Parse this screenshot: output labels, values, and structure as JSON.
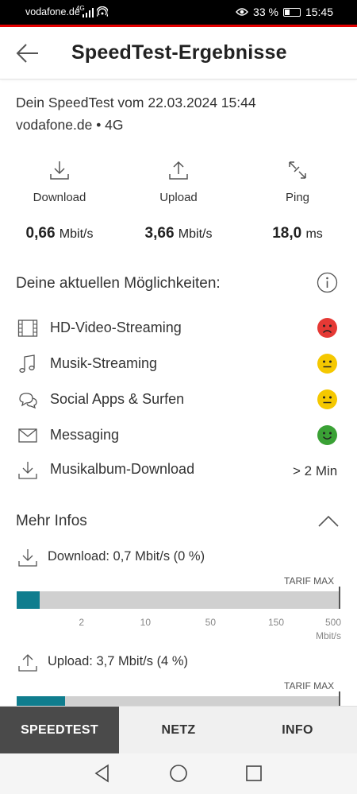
{
  "status": {
    "carrier": "vodafone.de",
    "network_badge": "4G",
    "battery": "33 %",
    "time": "15:45"
  },
  "header": {
    "title": "SpeedTest-Ergebnisse"
  },
  "test_info": {
    "line1": "Dein SpeedTest vom 22.03.2024 15:44",
    "line2": "vodafone.de • 4G"
  },
  "metrics": [
    {
      "label": "Download",
      "value": "0,66",
      "unit": "Mbit/s",
      "icon": "download-icon"
    },
    {
      "label": "Upload",
      "value": "3,66",
      "unit": "Mbit/s",
      "icon": "upload-icon"
    },
    {
      "label": "Ping",
      "value": "18,0",
      "unit": "ms",
      "icon": "ping-icon"
    }
  ],
  "capabilities": {
    "title": "Deine aktuellen Möglichkeiten:",
    "items": [
      {
        "label": "HD-Video-Streaming",
        "icon": "film-icon",
        "status": "sad",
        "color": "#e53935"
      },
      {
        "label": "Musik-Streaming",
        "icon": "music-note-icon",
        "status": "neutral",
        "color": "#f5c800"
      },
      {
        "label": "Social Apps & Surfen",
        "icon": "chat-bubbles-icon",
        "status": "neutral",
        "color": "#f5c800"
      },
      {
        "label": "Messaging",
        "icon": "envelope-icon",
        "status": "happy",
        "color": "#3aa135"
      },
      {
        "label": "Musikalbum-Download",
        "icon": "download-icon",
        "value": "> 2 Min"
      }
    ]
  },
  "more_info": {
    "title": "Mehr Infos",
    "download_label": "Download: 0,7 Mbit/s (0 %)",
    "upload_label": "Upload: 3,7 Mbit/s (4 %)",
    "tarif_max": "TARIF MAX",
    "ticks": [
      "2",
      "10",
      "50",
      "150",
      "500"
    ],
    "unit": "Mbit/s",
    "download_fill_fraction": 0.07,
    "upload_fill_fraction": 0.15,
    "accent_color": "#0f7d8e"
  },
  "tabs": [
    {
      "label": "SPEEDTEST",
      "active": true
    },
    {
      "label": "NETZ",
      "active": false
    },
    {
      "label": "INFO",
      "active": false
    }
  ]
}
